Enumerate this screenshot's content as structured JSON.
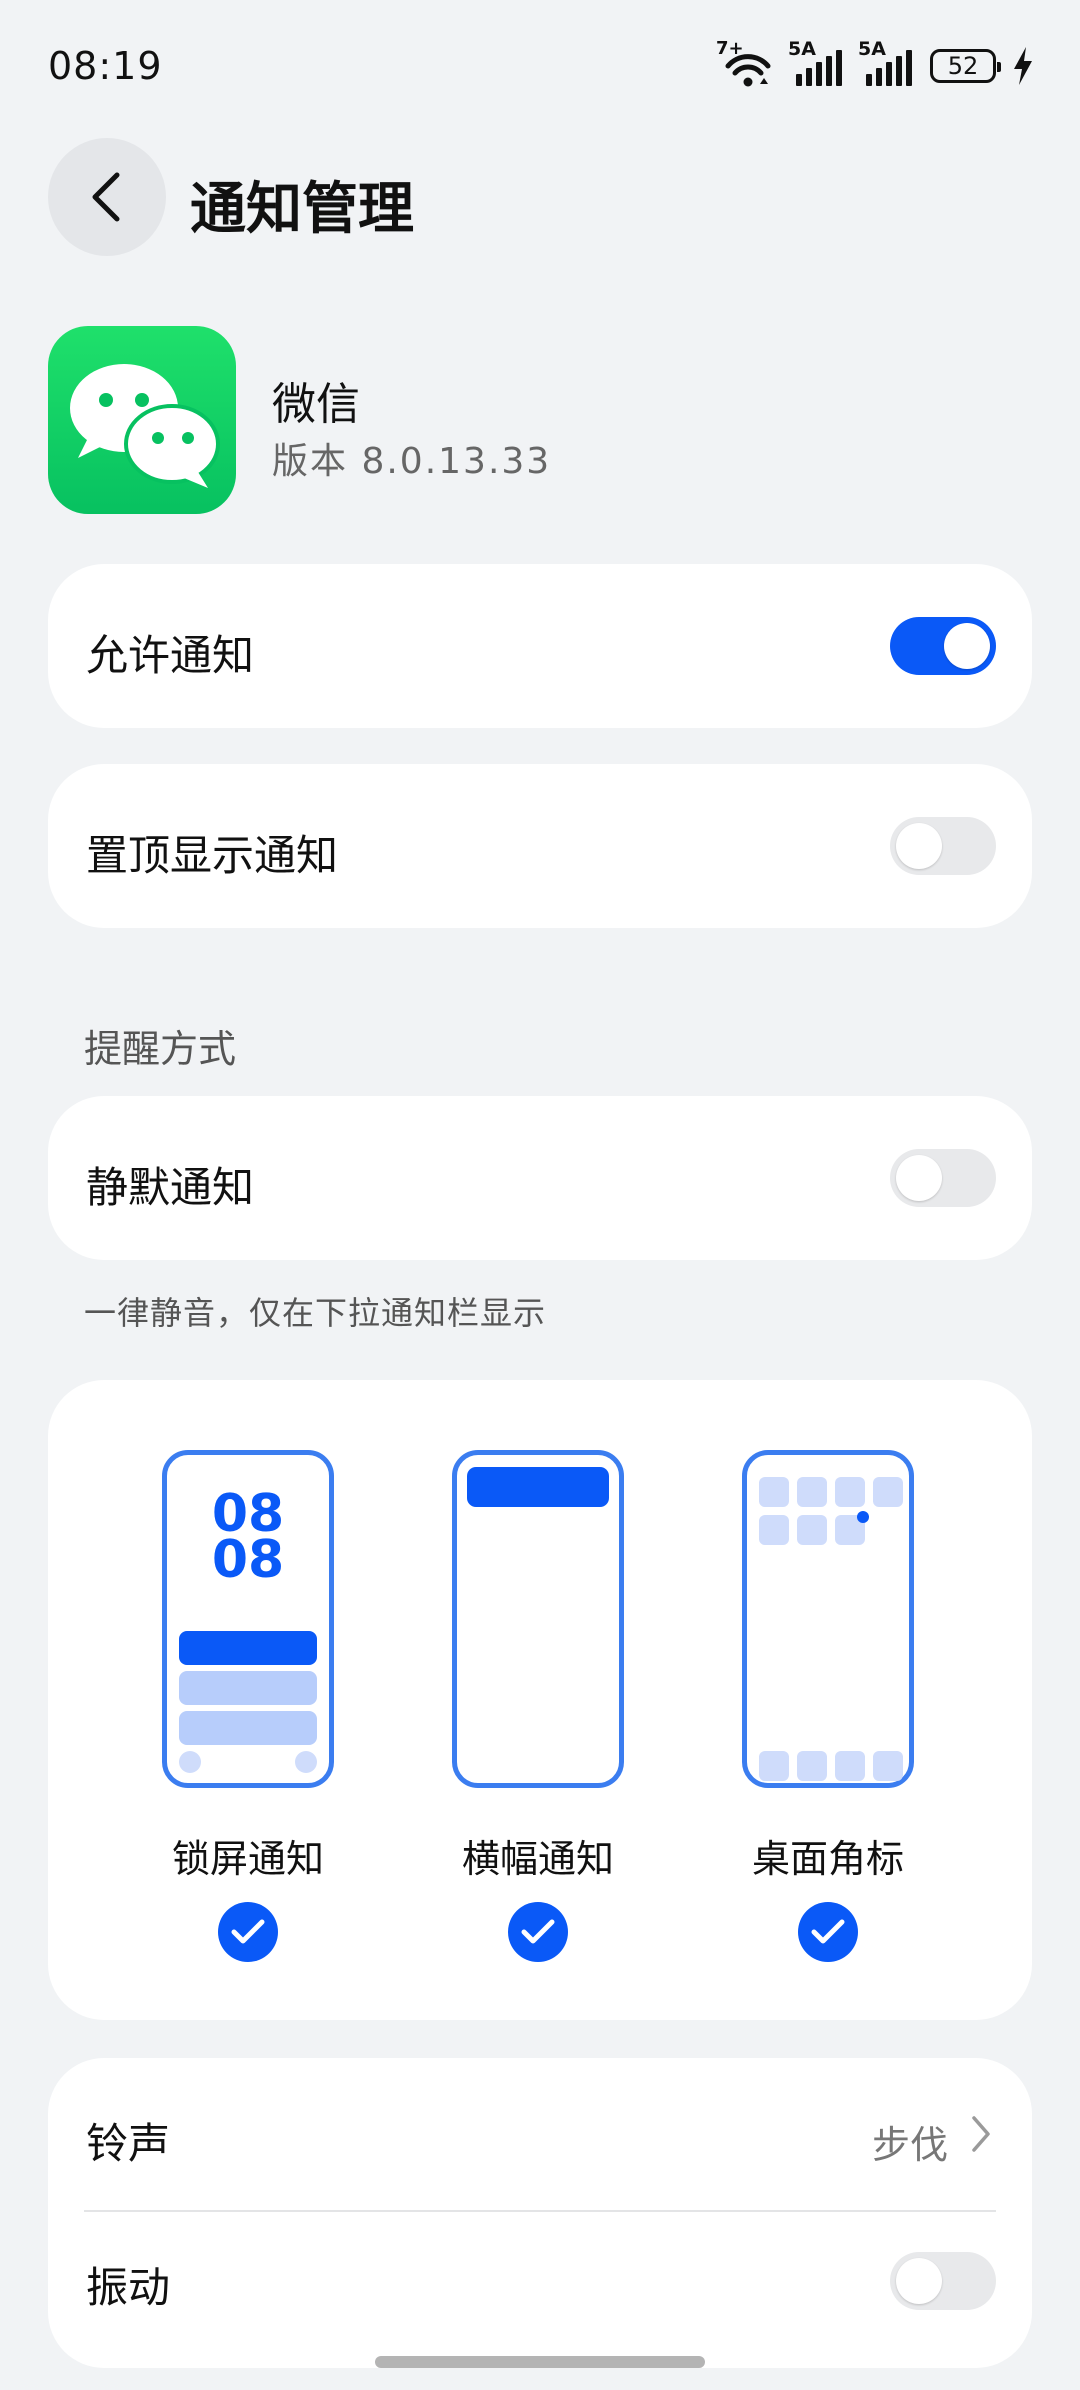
{
  "status_bar": {
    "time": "08:19",
    "wifi_label": "7+",
    "signal1_label": "5A",
    "signal2_label": "5A",
    "battery": "52"
  },
  "header": {
    "title": "通知管理"
  },
  "app": {
    "name": "微信",
    "version": "版本 8.0.13.33"
  },
  "allow_notifications": {
    "label": "允许通知",
    "enabled": true
  },
  "pin_top": {
    "label": "置顶显示通知",
    "enabled": false
  },
  "reminder_section": {
    "title": "提醒方式"
  },
  "silent": {
    "label": "静默通知",
    "enabled": false,
    "hint": "一律静音，仅在下拉通知栏显示"
  },
  "styles": {
    "lockscreen_clock_top": "08",
    "lockscreen_clock_bottom": "08",
    "items": [
      {
        "label": "锁屏通知",
        "checked": true
      },
      {
        "label": "横幅通知",
        "checked": true
      },
      {
        "label": "桌面角标",
        "checked": true
      }
    ]
  },
  "ringtone": {
    "label": "铃声",
    "value": "步伐"
  },
  "vibration": {
    "label": "振动",
    "enabled": false
  },
  "colors": {
    "accent": "#0a59f7",
    "background": "#f1f3f5",
    "wechat_green": "#07c160"
  }
}
